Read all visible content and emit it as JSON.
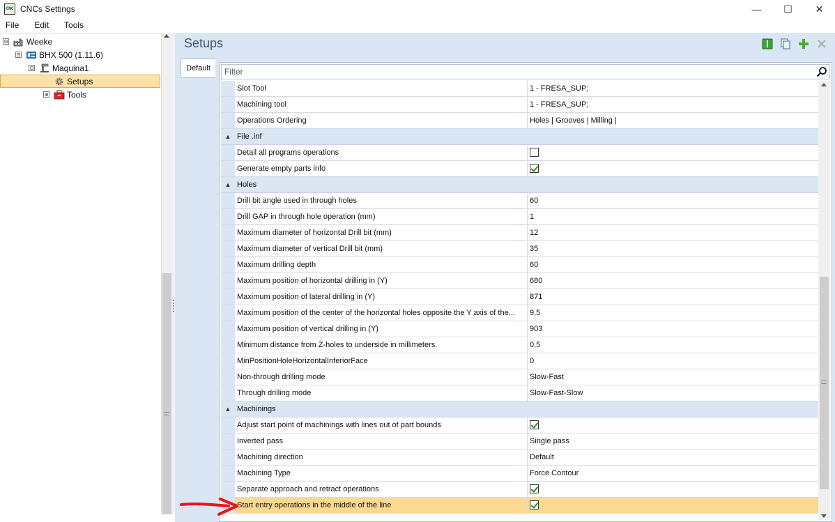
{
  "window": {
    "title": "CNCs Settings",
    "icon_label": "CNC",
    "controls": {
      "minimize": "—",
      "maximize": "☐",
      "close": "✕"
    }
  },
  "menu": [
    "File",
    "Edit",
    "Tools"
  ],
  "tree": {
    "items": [
      {
        "label": "Weeke",
        "expander": "⊟",
        "icon": "factory-icon"
      },
      {
        "label": "BHX 500 (1.11.6)",
        "expander": "⊟",
        "icon": "machine-brand-icon"
      },
      {
        "label": "Maquina1",
        "expander": "⊟",
        "icon": "machine-icon"
      },
      {
        "label": "Setups",
        "expander": "",
        "icon": "gear-icon",
        "selected": true
      },
      {
        "label": "Tools",
        "expander": "⊞",
        "icon": "toolbox-icon"
      }
    ]
  },
  "panel": {
    "title": "Setups",
    "tab": "Default",
    "filter_placeholder": "Filter",
    "toolbar": [
      "info-icon",
      "copy-icon",
      "add-icon",
      "delete-icon"
    ]
  },
  "grid": {
    "rows": [
      {
        "kind": "prop",
        "name": "Slot Tool",
        "value": "1 - FRESA_SUP;"
      },
      {
        "kind": "prop",
        "name": "Machining tool",
        "value": "1 - FRESA_SUP;"
      },
      {
        "kind": "prop",
        "name": "Operations Ordering",
        "value": "Holes | Grooves | Milling |"
      },
      {
        "kind": "cat",
        "name": "File .inf"
      },
      {
        "kind": "prop",
        "name": "Detail all programs operations",
        "check": false
      },
      {
        "kind": "prop",
        "name": "Generate empty parts info",
        "check": true
      },
      {
        "kind": "cat",
        "name": "Holes"
      },
      {
        "kind": "prop",
        "name": "Drill bit angle used in through holes",
        "value": "60"
      },
      {
        "kind": "prop",
        "name": "Drill GAP in through hole operation (mm)",
        "value": "1"
      },
      {
        "kind": "prop",
        "name": "Maximum diameter of horizontal Drill bit (mm)",
        "value": "12"
      },
      {
        "kind": "prop",
        "name": "Maximum diameter of vertical Drill bit (mm)",
        "value": "35"
      },
      {
        "kind": "prop",
        "name": "Maximum drilling depth",
        "value": "60"
      },
      {
        "kind": "prop",
        "name": "Maximum position of horizontal drilling in (Y)",
        "value": "680"
      },
      {
        "kind": "prop",
        "name": "Maximum position of lateral drilling in (Y)",
        "value": "871"
      },
      {
        "kind": "prop",
        "name": "Maximum position of the center of the horizontal holes opposite the Y axis of the...",
        "value": "9,5"
      },
      {
        "kind": "prop",
        "name": "Maximum position of vertical drilling in (Y)",
        "value": "903"
      },
      {
        "kind": "prop",
        "name": "Minimum distance from Z-holes to underside in millimeters.",
        "value": "0,5"
      },
      {
        "kind": "prop",
        "name": "MinPositionHoleHorizontalInferiorFace",
        "value": "0"
      },
      {
        "kind": "prop",
        "name": "Non-through drilling mode",
        "value": "Slow-Fast"
      },
      {
        "kind": "prop",
        "name": "Through drilling mode",
        "value": "Slow-Fast-Slow"
      },
      {
        "kind": "cat",
        "name": "Machinings"
      },
      {
        "kind": "prop",
        "name": "Adjust start point of machinings with lines out of part bounds",
        "check": true
      },
      {
        "kind": "prop",
        "name": "Inverted pass",
        "value": "Single pass"
      },
      {
        "kind": "prop",
        "name": "Machining direction",
        "value": "Default"
      },
      {
        "kind": "prop",
        "name": "Machining Type",
        "value": "Force Contour"
      },
      {
        "kind": "prop",
        "name": "Separate approach and retract operations",
        "check": true
      },
      {
        "kind": "prop",
        "name": "Start entry operations in the middle of the line",
        "check": true,
        "selected": true
      }
    ]
  },
  "colors": {
    "selection": "#fcd98f",
    "category": "#dbe6f4",
    "annotation_arrow": "#e8141c"
  }
}
